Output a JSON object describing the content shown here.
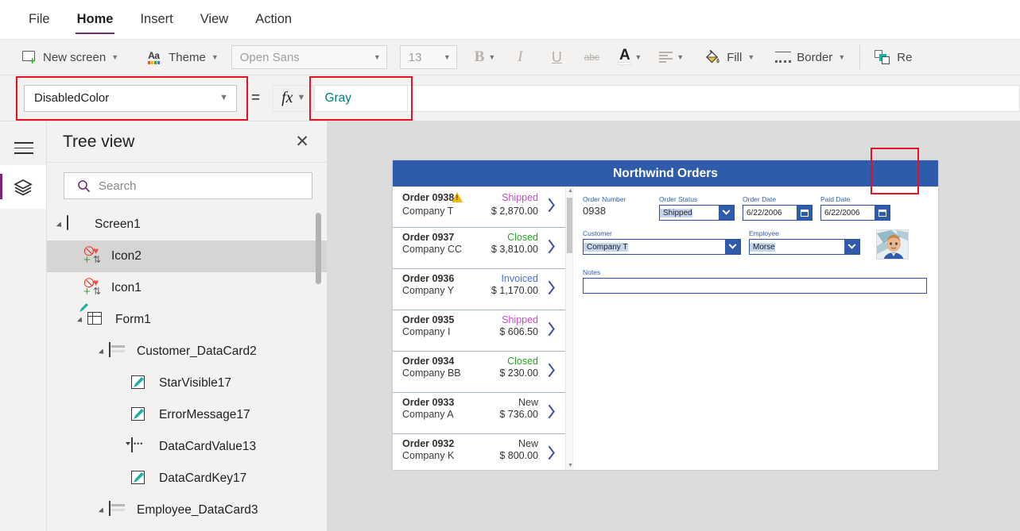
{
  "menubar": {
    "items": [
      {
        "label": "File",
        "active": false
      },
      {
        "label": "Home",
        "active": true
      },
      {
        "label": "Insert",
        "active": false
      },
      {
        "label": "View",
        "active": false
      },
      {
        "label": "Action",
        "active": false
      }
    ]
  },
  "ribbon": {
    "new_screen": "New screen",
    "theme": "Theme",
    "font_family": "Open Sans",
    "font_size": "13",
    "bold": "B",
    "italic": "I",
    "underline": "U",
    "strikethrough": "abc",
    "font_color": "A",
    "align": "align",
    "fill": "Fill",
    "border": "Border",
    "reorder": "Re"
  },
  "formula_bar": {
    "property": "DisabledColor",
    "equals": "=",
    "fx": "fx",
    "formula": "Gray",
    "formula_color": "#007b83",
    "highlight_color": "#e81123"
  },
  "tree_panel": {
    "title": "Tree view",
    "close": "✕",
    "search_placeholder": "Search",
    "search_value": "",
    "items": [
      {
        "label": "Screen1",
        "depth": 0,
        "icon": "screen-icon",
        "caret": "open",
        "selected": false
      },
      {
        "label": "Icon2",
        "depth": 1,
        "icon": "icon-states-icon",
        "caret": "none",
        "selected": true
      },
      {
        "label": "Icon1",
        "depth": 1,
        "icon": "icon-states-icon",
        "caret": "none",
        "selected": false
      },
      {
        "label": "Form1",
        "depth": 1,
        "icon": "form-icon",
        "caret": "open",
        "selected": false
      },
      {
        "label": "Customer_DataCard2",
        "depth": 2,
        "icon": "datacard-icon",
        "caret": "open",
        "selected": false
      },
      {
        "label": "StarVisible17",
        "depth": 3,
        "icon": "edit-icon",
        "caret": "none",
        "selected": false
      },
      {
        "label": "ErrorMessage17",
        "depth": 3,
        "icon": "edit-icon",
        "caret": "none",
        "selected": false
      },
      {
        "label": "DataCardValue13",
        "depth": 3,
        "icon": "dropdown-icon",
        "caret": "none",
        "selected": false
      },
      {
        "label": "DataCardKey17",
        "depth": 3,
        "icon": "edit-icon",
        "caret": "none",
        "selected": false
      },
      {
        "label": "Employee_DataCard3",
        "depth": 2,
        "icon": "datacard-icon",
        "caret": "open",
        "selected": false
      }
    ]
  },
  "app": {
    "title": "Northwind Orders",
    "header_color": "#2f5caa",
    "status_colors": {
      "Shipped": "#bf4fbf",
      "Closed": "#27a327",
      "Invoiced": "#4a6fd4",
      "New": "#3b3a39"
    },
    "orders": [
      {
        "id": "Order 0938",
        "company": "Company T",
        "status": "Shipped",
        "amount": "$ 2,870.00",
        "warning": true
      },
      {
        "id": "Order 0937",
        "company": "Company CC",
        "status": "Closed",
        "amount": "$ 3,810.00",
        "warning": false
      },
      {
        "id": "Order 0936",
        "company": "Company Y",
        "status": "Invoiced",
        "amount": "$ 1,170.00",
        "warning": false
      },
      {
        "id": "Order 0935",
        "company": "Company I",
        "status": "Shipped",
        "amount": "$ 606.50",
        "warning": false
      },
      {
        "id": "Order 0934",
        "company": "Company BB",
        "status": "Closed",
        "amount": "$ 230.00",
        "warning": false
      },
      {
        "id": "Order 0933",
        "company": "Company A",
        "status": "New",
        "amount": "$ 736.00",
        "warning": false
      },
      {
        "id": "Order 0932",
        "company": "Company K",
        "status": "New",
        "amount": "$ 800.00",
        "warning": false
      }
    ],
    "form": {
      "order_number_label": "Order Number",
      "order_number_value": "0938",
      "order_status_label": "Order Status",
      "order_status_value": "Shipped",
      "order_date_label": "Order Date",
      "order_date_value": "6/22/2006",
      "paid_date_label": "Paid Date",
      "paid_date_value": "6/22/2006",
      "customer_label": "Customer",
      "customer_value": "Company T",
      "employee_label": "Employee",
      "employee_value": "Morse",
      "notes_label": "Notes",
      "notes_value": ""
    }
  }
}
